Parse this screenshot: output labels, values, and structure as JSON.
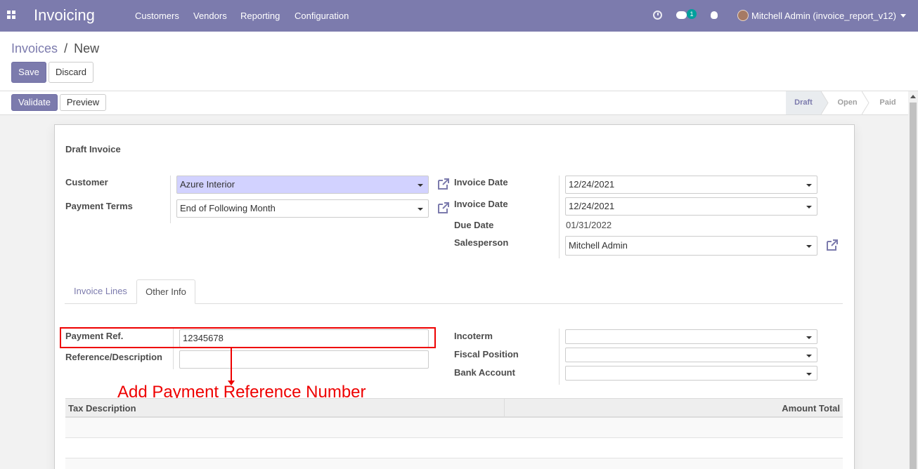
{
  "navbar": {
    "app_title": "Invoicing",
    "menu": [
      "Customers",
      "Vendors",
      "Reporting",
      "Configuration"
    ],
    "chat_badge": "1",
    "user": "Mitchell Admin (invoice_report_v12)",
    "color": "#7c7bad"
  },
  "breadcrumb": {
    "parent": "Invoices",
    "separator": "/",
    "current": "New"
  },
  "actions": {
    "save": "Save",
    "discard": "Discard"
  },
  "statusbar": {
    "validate": "Validate",
    "preview": "Preview",
    "steps": [
      "Draft",
      "Open",
      "Paid"
    ],
    "active_step": "Draft"
  },
  "form": {
    "heading": "Draft Invoice",
    "customer_label": "Customer",
    "customer_value": "Azure Interior",
    "payment_terms_label": "Payment Terms",
    "payment_terms_value": "End of Following Month",
    "invoice_date_label": "Invoice Date",
    "invoice_date_value": "12/24/2021",
    "invoice_date2_label": "Invoice Date",
    "invoice_date2_value": "12/24/2021",
    "due_date_label": "Due Date",
    "due_date_value": "01/31/2022",
    "salesperson_label": "Salesperson",
    "salesperson_value": "Mitchell Admin"
  },
  "tabs": [
    "Invoice Lines",
    "Other Info"
  ],
  "active_tab": "Other Info",
  "other_info": {
    "payment_ref_label": "Payment Ref.",
    "payment_ref_value": "12345678",
    "reference_label": "Reference/Description",
    "reference_value": "",
    "incoterm_label": "Incoterm",
    "incoterm_value": "",
    "fiscal_position_label": "Fiscal Position",
    "fiscal_position_value": "",
    "bank_account_label": "Bank Account",
    "bank_account_value": ""
  },
  "annotation": {
    "text": "Add Payment Reference Number",
    "color": "#ee0000"
  },
  "tax_table": {
    "columns": [
      "Tax Description",
      "Amount Total"
    ]
  }
}
